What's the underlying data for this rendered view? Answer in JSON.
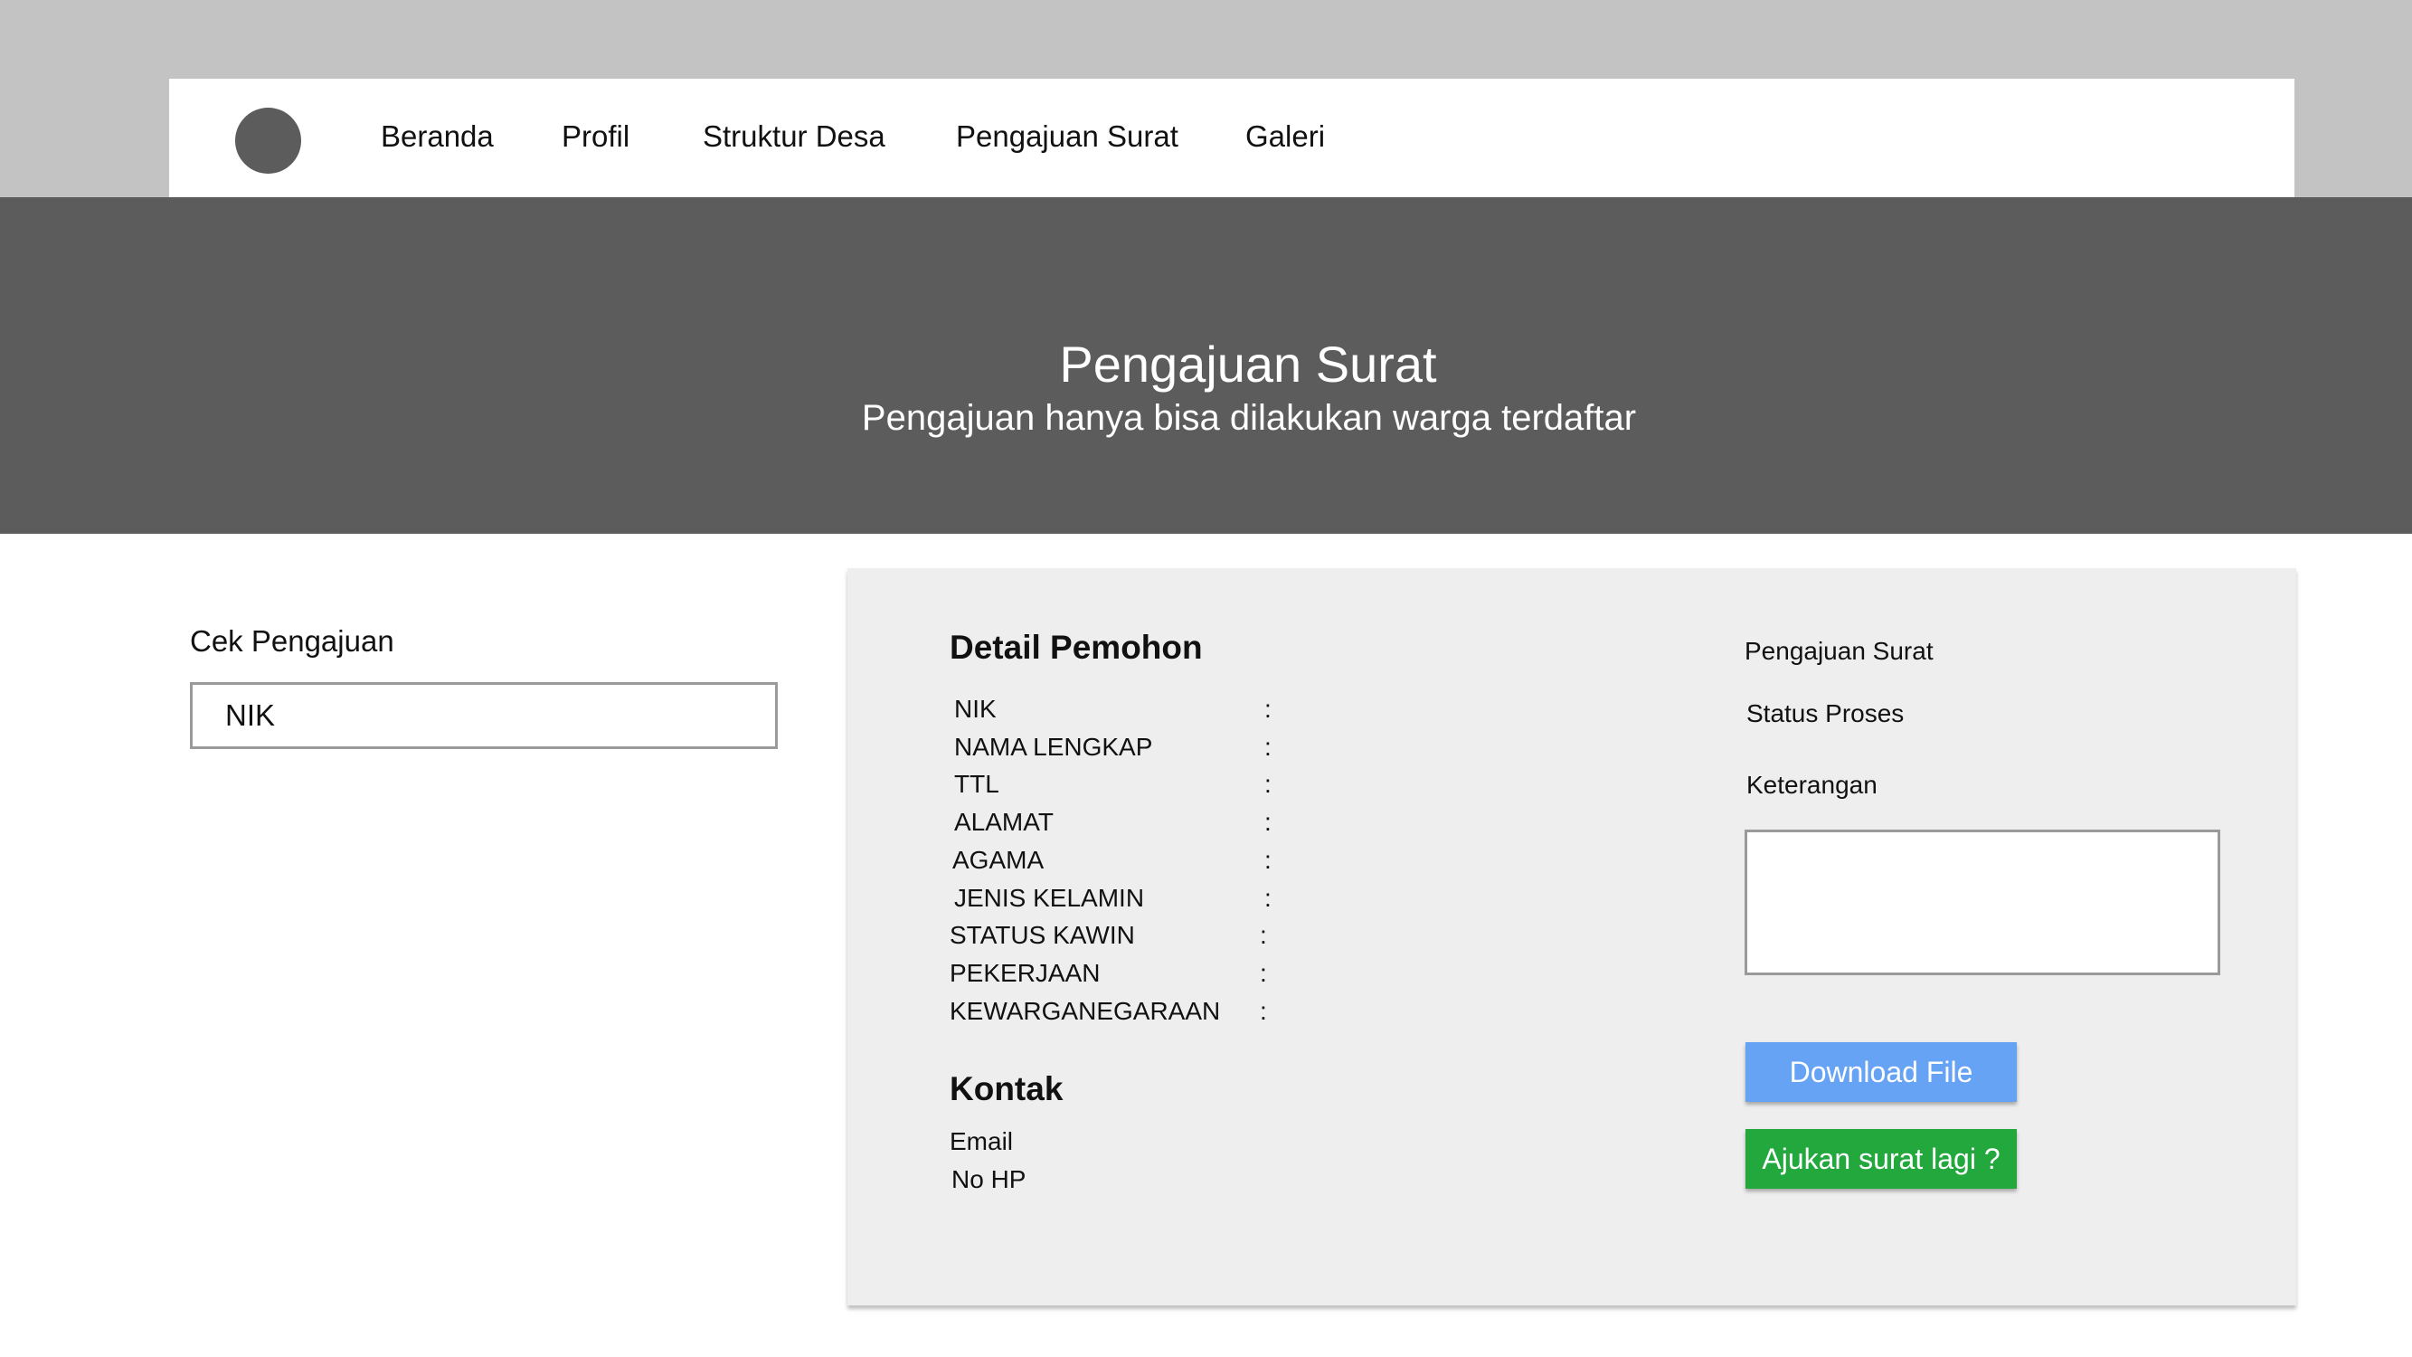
{
  "nav": {
    "items": [
      {
        "label": "Beranda"
      },
      {
        "label": "Profil"
      },
      {
        "label": "Struktur Desa"
      },
      {
        "label": "Pengajuan Surat"
      },
      {
        "label": "Galeri"
      }
    ]
  },
  "hero": {
    "title": "Pengajuan Surat",
    "subtitle": "Pengajuan hanya bisa dilakukan warga terdaftar"
  },
  "cek": {
    "label": "Cek Pengajuan",
    "placeholder": "NIK"
  },
  "detail": {
    "title": "Detail Pemohon",
    "separator": ":",
    "fields": [
      {
        "label": "NIK"
      },
      {
        "label": "NAMA LENGKAP"
      },
      {
        "label": "TTL"
      },
      {
        "label": "ALAMAT"
      },
      {
        "label": "AGAMA"
      },
      {
        "label": "JENIS KELAMIN"
      },
      {
        "label": "STATUS KAWIN"
      },
      {
        "label": "PEKERJAAN"
      },
      {
        "label": "KEWARGANEGARAAN"
      }
    ]
  },
  "kontak": {
    "title": "Kontak",
    "email_label": "Email",
    "phone_label": "No HP"
  },
  "status": {
    "pengajuan_label": "Pengajuan Surat",
    "status_label": "Status Proses",
    "keterangan_label": "Keterangan"
  },
  "buttons": {
    "download": "Download File",
    "ajukan": "Ajukan surat lagi ?"
  },
  "colors": {
    "download": "#66a3f5",
    "ajukan": "#22a83c",
    "hero": "#5c5c5c"
  }
}
